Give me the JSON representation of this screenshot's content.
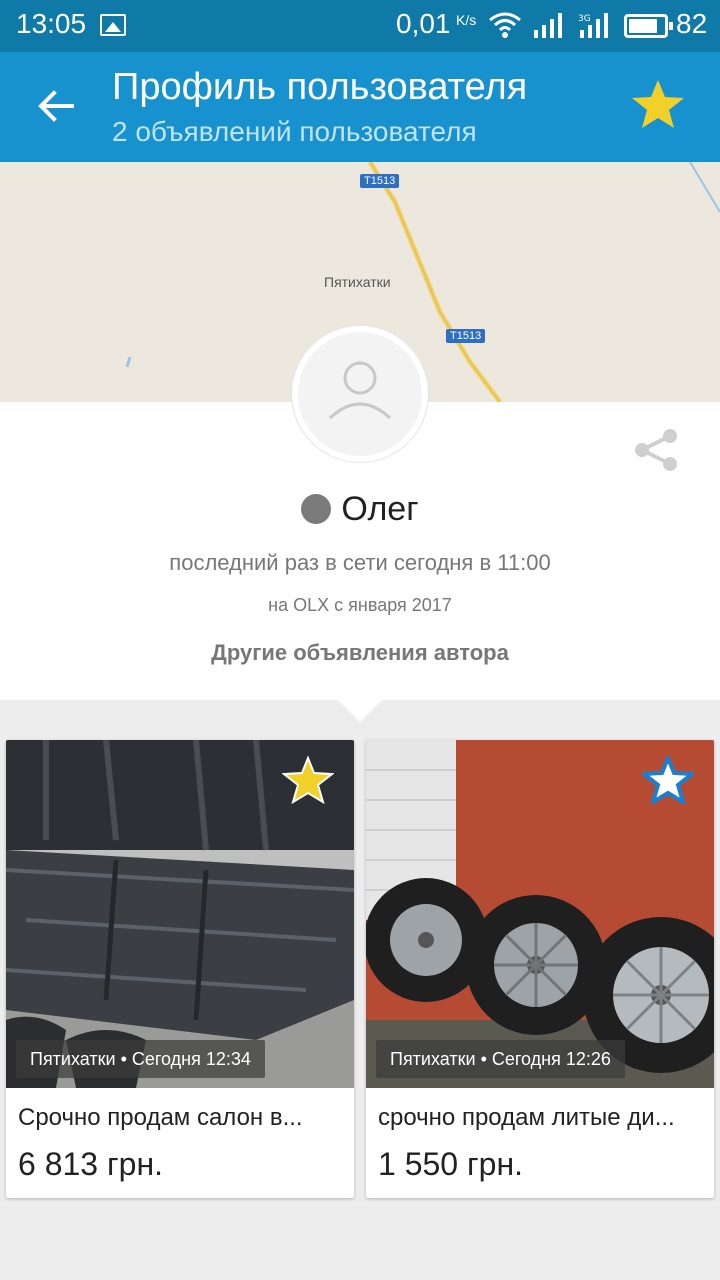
{
  "status_bar": {
    "time": "13:05",
    "speed": "0,01",
    "speed_unit": "K/s",
    "network": "3G",
    "battery": "82",
    "battery_level": 0.82
  },
  "header": {
    "title": "Профиль пользователя",
    "subtitle": "2 объявлений пользователя",
    "back_icon": "arrow-left-icon",
    "favorite_icon": "star-icon"
  },
  "map": {
    "town": "Пятихатки",
    "road_label_1": "T1513",
    "road_label_2": "T1513"
  },
  "profile": {
    "name": "Олег",
    "last_seen": "последний раз в сети сегодня в 11:00",
    "member_since": "на OLX с января 2017",
    "other_ads_label": "Другие объявления автора"
  },
  "ads": [
    {
      "location_time": "Пятихатки • Сегодня 12:34",
      "title": "Срочно продам салон в...",
      "price": "6 813 грн.",
      "favorited": true
    },
    {
      "location_time": "Пятихатки • Сегодня 12:26",
      "title": "срочно продам литые ди...",
      "price": "1 550 грн.",
      "favorited": false
    }
  ],
  "colors": {
    "status_bar": "#0f79a7",
    "app_bar": "#1891cf",
    "star_gold": "#f2d02a",
    "star_blue": "#1b7fd0"
  }
}
